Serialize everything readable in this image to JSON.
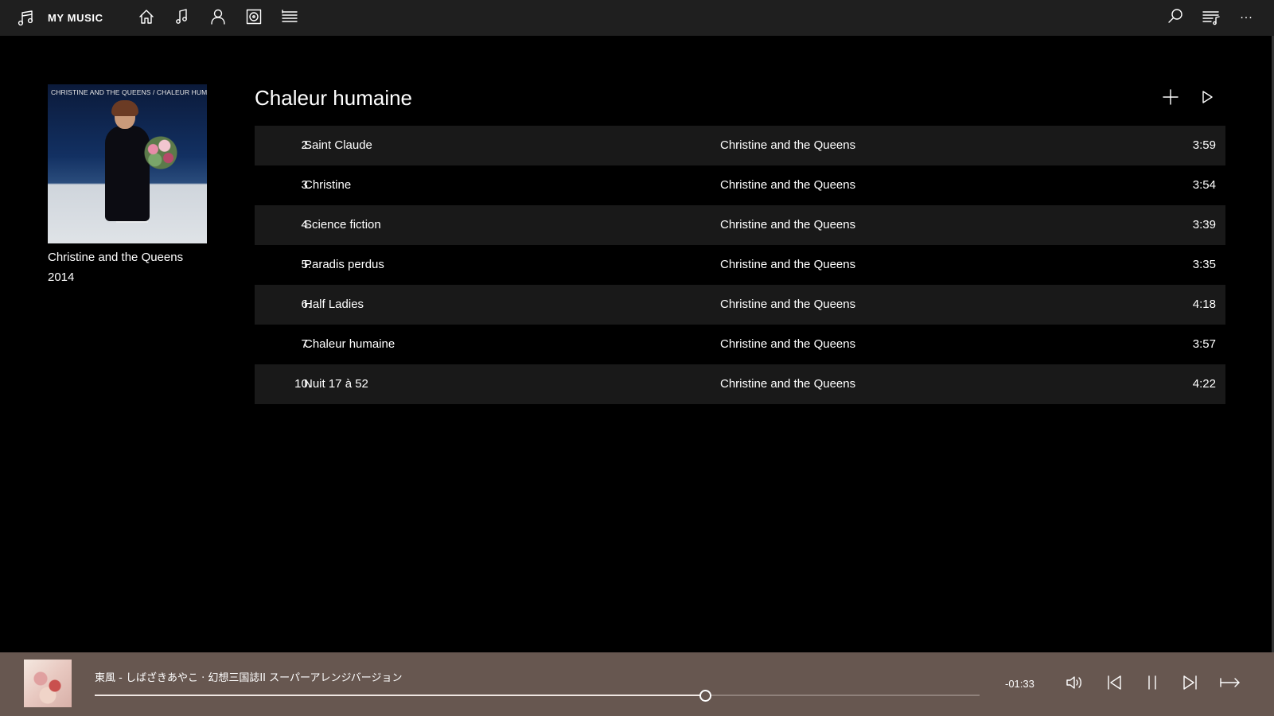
{
  "app": {
    "title": "MY MUSIC",
    "brand_icon": "music-note-icon"
  },
  "nav": {
    "items": [
      {
        "name": "home",
        "icon": "home-icon"
      },
      {
        "name": "songs",
        "icon": "music-note-icon"
      },
      {
        "name": "artists",
        "icon": "person-icon"
      },
      {
        "name": "albums",
        "icon": "album-icon"
      },
      {
        "name": "playlists",
        "icon": "playlist-icon"
      }
    ]
  },
  "tools": {
    "search_icon": "search-icon",
    "now_playing_icon": "queue-icon",
    "more_label": "···"
  },
  "album": {
    "title": "Chaleur humaine",
    "artist": "Christine and the Queens",
    "year": "2014",
    "cover_text": "CHRISTINE AND THE QUEENS / CHALEUR HUMAINE"
  },
  "tracks": [
    {
      "number": "2.",
      "title": "Saint Claude",
      "artist": "Christine and the Queens",
      "duration": "3:59"
    },
    {
      "number": "3.",
      "title": "Christine",
      "artist": "Christine and the Queens",
      "duration": "3:54"
    },
    {
      "number": "4.",
      "title": "Science fiction",
      "artist": "Christine and the Queens",
      "duration": "3:39"
    },
    {
      "number": "5.",
      "title": "Paradis perdus",
      "artist": "Christine and the Queens",
      "duration": "3:35"
    },
    {
      "number": "6.",
      "title": "Half Ladies",
      "artist": "Christine and the Queens",
      "duration": "4:18"
    },
    {
      "number": "7.",
      "title": "Chaleur humaine",
      "artist": "Christine and the Queens",
      "duration": "3:57"
    },
    {
      "number": "10.",
      "title": "Nuit 17 à 52",
      "artist": "Christine and the Queens",
      "duration": "4:22"
    }
  ],
  "player": {
    "now_playing": "東風 - しばざきあやこ · 幻想三国誌II スーパーアレンジバージョン",
    "remaining": "-01:33",
    "progress_fraction": 0.69,
    "background": "#675750"
  }
}
